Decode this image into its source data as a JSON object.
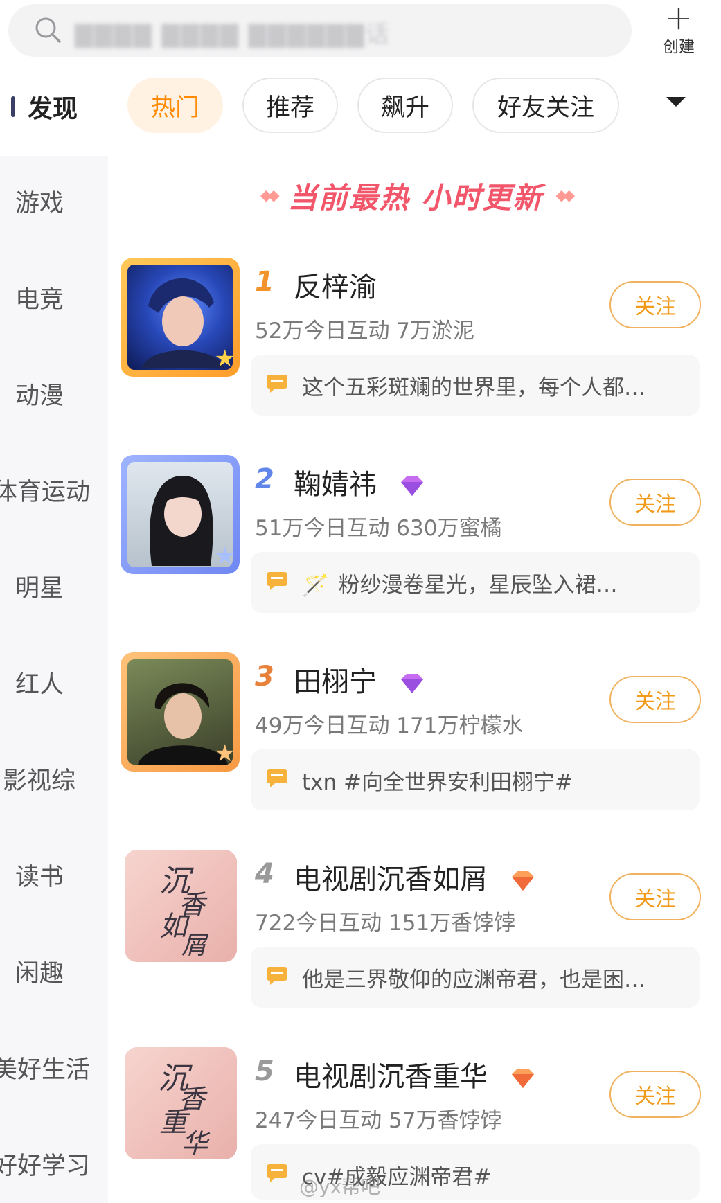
{
  "header": {
    "search_placeholder": "▇▇▇▇ ▇▇▇▇ ▇▇▇▇▇▇话",
    "create_label": "创建"
  },
  "discover_label": "发现",
  "tabs": [
    {
      "label": "热门",
      "active": true
    },
    {
      "label": "推荐",
      "active": false
    },
    {
      "label": "飙升",
      "active": false
    },
    {
      "label": "好友关注",
      "active": false
    }
  ],
  "sidebar": {
    "items": [
      "游戏",
      "电竞",
      "动漫",
      "体育运动",
      "明星",
      "红人",
      "影视综",
      "读书",
      "闲趣",
      "美好生活",
      "好好学习"
    ]
  },
  "banner": {
    "text": "当前最热 小时更新"
  },
  "entries": [
    {
      "rank": "1",
      "name": "反梓渝",
      "stats": "52万今日互动 7万淤泥",
      "follow": "关注",
      "quote": "这个五彩斑斓的世界里，每个人都…",
      "badge": ""
    },
    {
      "rank": "2",
      "name": "鞠婧祎",
      "stats": "51万今日互动 630万蜜橘",
      "follow": "关注",
      "quote": "粉纱漫卷星光，星辰坠入裙…",
      "badge": "purple"
    },
    {
      "rank": "3",
      "name": "田栩宁",
      "stats": "49万今日互动 171万柠檬水",
      "follow": "关注",
      "quote": "txn  #向全世界安利田栩宁#",
      "badge": "purple"
    },
    {
      "rank": "4",
      "name": "电视剧沉香如屑",
      "stats": "722今日互动 151万香饽饽",
      "follow": "关注",
      "quote": "他是三界敬仰的应渊帝君，也是困…",
      "badge": "orange"
    },
    {
      "rank": "5",
      "name": "电视剧沉香重华",
      "stats": "247今日互动 57万香饽饽",
      "follow": "关注",
      "quote": "cv#成毅应渊帝君#",
      "badge": "orange"
    }
  ],
  "watermark": "@yx帮吧",
  "colors": {
    "accent_orange": "#ff8a00",
    "banner_red": "#f2566a",
    "follow_border": "#f0b25f"
  }
}
